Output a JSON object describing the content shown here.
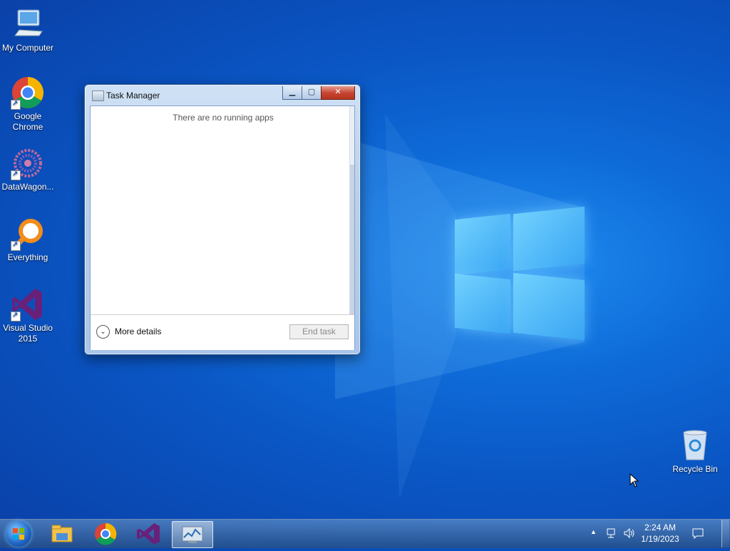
{
  "desktop": {
    "icons": [
      {
        "label": "My Computer",
        "icon": "computer-icon"
      },
      {
        "label": "Google Chrome",
        "icon": "chrome-icon"
      },
      {
        "label": "DataWagon...",
        "icon": "datawagon-icon"
      },
      {
        "label": "Everything",
        "icon": "everything-search-icon"
      },
      {
        "label": "Visual Studio 2015",
        "icon": "visual-studio-icon"
      },
      {
        "label": "Recycle Bin",
        "icon": "recycle-bin-icon"
      }
    ]
  },
  "task_manager": {
    "title": "Task Manager",
    "empty_message": "There are no running apps",
    "more_details_label": "More details",
    "end_task_label": "End task",
    "controls": {
      "minimize": "minimize-icon",
      "maximize": "maximize-icon",
      "close": "close-icon"
    }
  },
  "taskbar": {
    "pinned": [
      "file-explorer-icon",
      "chrome-icon",
      "visual-studio-icon",
      "task-manager-icon"
    ],
    "active_item": "task-manager-icon",
    "tray_icons": [
      "show-hidden-icons-chevron",
      "network-icon",
      "volume-icon"
    ],
    "time": "2:24 AM",
    "date": "1/19/2023",
    "notification_icon": "action-center-icon"
  },
  "colors": {
    "wallpaper_primary": "#0a56c4",
    "wallpaper_glow": "#1f8cf0",
    "window_frame": "#b8d1ee",
    "close_button": "#c4432f"
  }
}
